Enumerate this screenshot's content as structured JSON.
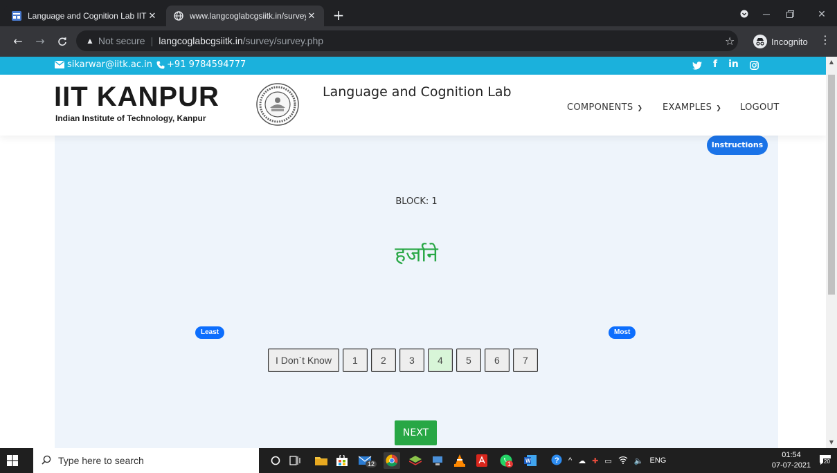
{
  "browser": {
    "tabs": [
      {
        "title": "Language and Cognition Lab IITK",
        "close": "✕"
      },
      {
        "title": "www.langcoglabcgsiitk.in/survey/",
        "close": "✕"
      }
    ],
    "new_tab": "+",
    "address": {
      "warning": "▲",
      "security": "Not secure",
      "separator": "|",
      "host": "langcoglabcgsiitk.in",
      "path": "/survey/survey.php"
    },
    "profile": "Incognito"
  },
  "topbar": {
    "email": "sikarwar@iitk.ac.in",
    "phone": "+91 9784594777"
  },
  "header": {
    "logo_main": "IIT KANPUR",
    "logo_sub": "Indian Institute of Technology, Kanpur",
    "lab_name": "Language and Cognition Lab",
    "nav": {
      "components": "COMPONENTS",
      "examples": "EXAMPLES",
      "logout": "LOGOUT"
    }
  },
  "survey": {
    "instructions": "Instructions",
    "block_label": "BLOCK: 1",
    "word": "हर्जाने",
    "least": "Least",
    "most": "Most",
    "options": [
      "I Don`t Know",
      "1",
      "2",
      "3",
      "4",
      "5",
      "6",
      "7"
    ],
    "selected": "4",
    "next": "NEXT"
  },
  "taskbar": {
    "search_placeholder": "Type here to search",
    "mail_badge": "12",
    "whatsapp_badge": "1",
    "language": "ENG",
    "time": "01:54",
    "date": "07-07-2021",
    "notification_count": "20"
  }
}
